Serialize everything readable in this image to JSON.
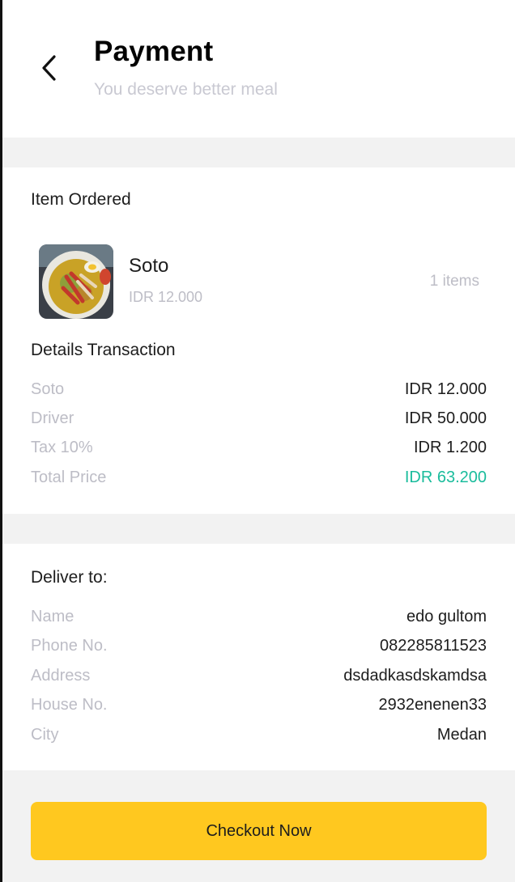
{
  "header": {
    "title": "Payment",
    "subtitle": "You deserve better meal"
  },
  "order": {
    "section_label": "Item Ordered",
    "item": {
      "name": "Soto",
      "price": "IDR 12.000",
      "quantity": "1 items"
    }
  },
  "transaction": {
    "section_label": "Details Transaction",
    "rows": [
      {
        "label": "Soto",
        "value": "IDR 12.000"
      },
      {
        "label": "Driver",
        "value": "IDR 50.000"
      },
      {
        "label": "Tax 10%",
        "value": "IDR 1.200"
      },
      {
        "label": "Total Price",
        "value": "IDR 63.200"
      }
    ]
  },
  "delivery": {
    "section_label": "Deliver to:",
    "rows": [
      {
        "label": "Name",
        "value": "edo gultom"
      },
      {
        "label": "Phone No.",
        "value": "082285811523"
      },
      {
        "label": "Address",
        "value": "dsdadkasdskamdsa"
      },
      {
        "label": "House No.",
        "value": "2932enenen33"
      },
      {
        "label": "City",
        "value": "Medan"
      }
    ]
  },
  "checkout": {
    "label": "Checkout Now"
  },
  "colors": {
    "accent": "#ffc81f",
    "total": "#1abc9c",
    "muted": "#bdbdc6"
  },
  "icons": {
    "back": "chevron-left-icon",
    "food": "soto-food-image"
  }
}
